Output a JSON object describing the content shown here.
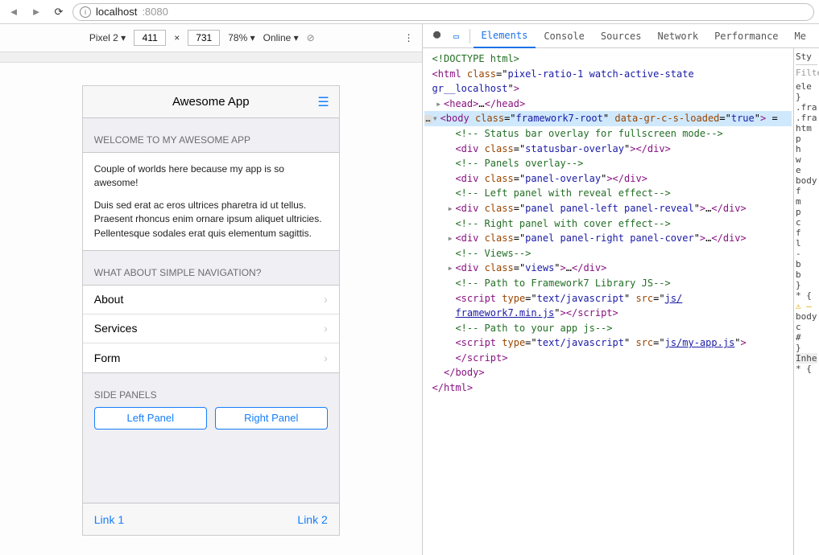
{
  "browser": {
    "url_host": "localhost",
    "url_port": ":8080"
  },
  "deviceBar": {
    "device": "Pixel 2",
    "w": "411",
    "h": "731",
    "zoom": "78%",
    "throttle": "Online"
  },
  "app": {
    "title": "Awesome App",
    "welcomeTitle": "WELCOME TO MY AWESOME APP",
    "welcomeLine1": "Couple of worlds here because my app is so awesome!",
    "welcomeLine2": "Duis sed erat ac eros ultrices pharetra id ut tellus. Praesent rhoncus enim ornare ipsum aliquet ultricies. Pellentesque sodales erat quis elementum sagittis.",
    "navTitle": "WHAT ABOUT SIMPLE NAVIGATION?",
    "navItems": [
      "About",
      "Services",
      "Form"
    ],
    "panelsTitle": "SIDE PANELS",
    "leftPanel": "Left Panel",
    "rightPanel": "Right Panel",
    "link1": "Link 1",
    "link2": "Link 2"
  },
  "devtools": {
    "tabs": [
      "Elements",
      "Console",
      "Sources",
      "Network",
      "Performance",
      "Me"
    ],
    "stylesHeader": "Sty",
    "filter": "Filte",
    "stylesLines": [
      "ele",
      "}",
      ".fra",
      "",
      ".fra",
      "htm",
      "  p",
      "  h",
      "  w",
      "  e",
      "",
      "body",
      "  f",
      "",
      "  m",
      "  p",
      "  c",
      "  f",
      "  l",
      "  -",
      "  b",
      "  b",
      "}",
      "* {",
      "⚠ —",
      "",
      "body",
      "  c",
      "  #",
      "}",
      "Inhe",
      "* {"
    ],
    "dom": [
      {
        "indent": 0,
        "tri": "",
        "html": "<span class='t-cmt'>&lt;!DOCTYPE html&gt;</span>"
      },
      {
        "indent": 0,
        "tri": "",
        "html": "<span class='t-punc'>&lt;</span><span class='t-tag'>html</span> <span class='t-attr'>class</span>=\"<span class='t-val'>pixel-ratio-1 watch-active-state</span>"
      },
      {
        "indent": 0,
        "tri": "",
        "html": "<span class='t-val'>gr__localhost</span>\"<span class='t-punc'>&gt;</span>"
      },
      {
        "indent": 1,
        "tri": "▸",
        "html": "<span class='t-punc'>&lt;</span><span class='t-tag'>head</span><span class='t-punc'>&gt;</span>…<span class='t-punc'>&lt;/</span><span class='t-tag'>head</span><span class='t-punc'>&gt;</span>"
      },
      {
        "indent": 0,
        "tri": "▾",
        "sel": true,
        "prefix": "…",
        "html": "<span class='t-punc'>&lt;</span><span class='t-tag'>body</span> <span class='t-attr'>class</span>=\"<span class='t-val'>framework7-root</span>\" <span class='t-attr'>data-gr-c-s-loaded</span>=\"<span class='t-val'>true</span>\"<span class='t-punc'>&gt;</span> ="
      },
      {
        "indent": 2,
        "tri": "",
        "html": "<span class='t-cmt'>&lt;!-- Status bar overlay for fullscreen mode--&gt;</span>"
      },
      {
        "indent": 2,
        "tri": "",
        "html": "<span class='t-punc'>&lt;</span><span class='t-tag'>div</span> <span class='t-attr'>class</span>=\"<span class='t-val'>statusbar-overlay</span>\"<span class='t-punc'>&gt;&lt;/</span><span class='t-tag'>div</span><span class='t-punc'>&gt;</span>"
      },
      {
        "indent": 2,
        "tri": "",
        "html": "<span class='t-cmt'>&lt;!-- Panels overlay--&gt;</span>"
      },
      {
        "indent": 2,
        "tri": "",
        "html": "<span class='t-punc'>&lt;</span><span class='t-tag'>div</span> <span class='t-attr'>class</span>=\"<span class='t-val'>panel-overlay</span>\"<span class='t-punc'>&gt;&lt;/</span><span class='t-tag'>div</span><span class='t-punc'>&gt;</span>"
      },
      {
        "indent": 2,
        "tri": "",
        "html": "<span class='t-cmt'>&lt;!-- Left panel with reveal effect--&gt;</span>"
      },
      {
        "indent": 2,
        "tri": "▸",
        "html": "<span class='t-punc'>&lt;</span><span class='t-tag'>div</span> <span class='t-attr'>class</span>=\"<span class='t-val'>panel panel-left panel-reveal</span>\"<span class='t-punc'>&gt;</span>…<span class='t-punc'>&lt;/</span><span class='t-tag'>div</span><span class='t-punc'>&gt;</span>"
      },
      {
        "indent": 2,
        "tri": "",
        "html": "<span class='t-cmt'>&lt;!-- Right panel with cover effect--&gt;</span>"
      },
      {
        "indent": 2,
        "tri": "▸",
        "html": "<span class='t-punc'>&lt;</span><span class='t-tag'>div</span> <span class='t-attr'>class</span>=\"<span class='t-val'>panel panel-right panel-cover</span>\"<span class='t-punc'>&gt;</span>…<span class='t-punc'>&lt;/</span><span class='t-tag'>div</span><span class='t-punc'>&gt;</span>"
      },
      {
        "indent": 2,
        "tri": "",
        "html": "<span class='t-cmt'>&lt;!-- Views--&gt;</span>"
      },
      {
        "indent": 2,
        "tri": "▸",
        "html": "<span class='t-punc'>&lt;</span><span class='t-tag'>div</span> <span class='t-attr'>class</span>=\"<span class='t-val'>views</span>\"<span class='t-punc'>&gt;</span>…<span class='t-punc'>&lt;/</span><span class='t-tag'>div</span><span class='t-punc'>&gt;</span>"
      },
      {
        "indent": 2,
        "tri": "",
        "html": "<span class='t-cmt'>&lt;!-- Path to Framework7 Library JS--&gt;</span>"
      },
      {
        "indent": 2,
        "tri": "",
        "html": "<span class='t-punc'>&lt;</span><span class='t-tag'>script</span> <span class='t-attr'>type</span>=\"<span class='t-val'>text/javascript</span>\" <span class='t-attr'>src</span>=\"<span class='t-val' style='text-decoration:underline'>js/</span>"
      },
      {
        "indent": 2,
        "tri": "",
        "html": "<span class='t-val' style='text-decoration:underline'>framework7.min.js</span>\"<span class='t-punc'>&gt;&lt;/</span><span class='t-tag'>script</span><span class='t-punc'>&gt;</span>"
      },
      {
        "indent": 2,
        "tri": "",
        "html": "<span class='t-cmt'>&lt;!-- Path to your app js--&gt;</span>"
      },
      {
        "indent": 2,
        "tri": "",
        "html": "<span class='t-punc'>&lt;</span><span class='t-tag'>script</span> <span class='t-attr'>type</span>=\"<span class='t-val'>text/javascript</span>\" <span class='t-attr'>src</span>=\"<span class='t-val' style='text-decoration:underline'>js/my-app.js</span>\"<span class='t-punc'>&gt;</span>"
      },
      {
        "indent": 2,
        "tri": "",
        "html": "<span class='t-punc'>&lt;/</span><span class='t-tag'>script</span><span class='t-punc'>&gt;</span>"
      },
      {
        "indent": 1,
        "tri": "",
        "html": "<span class='t-punc'>&lt;/</span><span class='t-tag'>body</span><span class='t-punc'>&gt;</span>"
      },
      {
        "indent": 0,
        "tri": "",
        "html": "<span class='t-punc'>&lt;/</span><span class='t-tag'>html</span><span class='t-punc'>&gt;</span>"
      }
    ]
  }
}
